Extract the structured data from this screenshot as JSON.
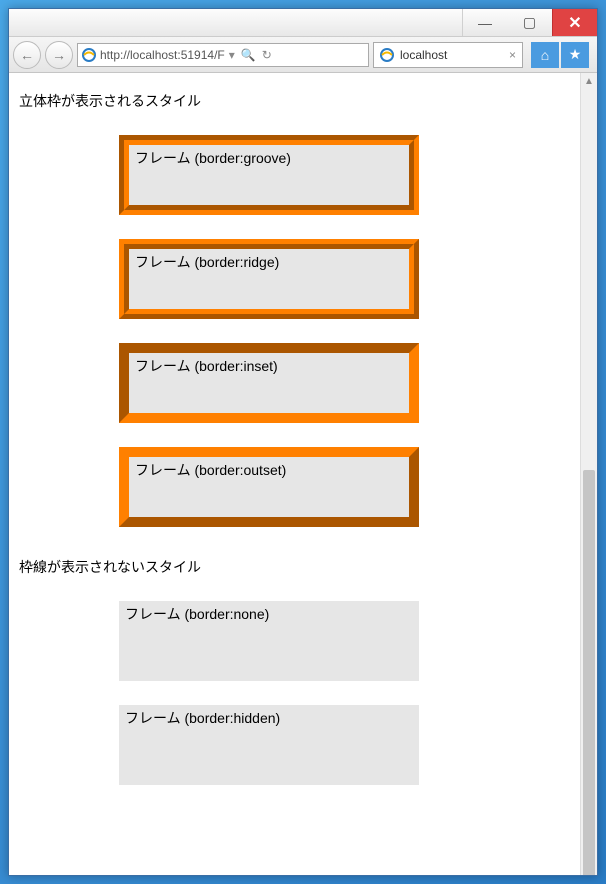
{
  "window": {
    "minimize_glyph": "—",
    "maximize_glyph": "▢",
    "close_glyph": "✕"
  },
  "nav": {
    "back_glyph": "←",
    "forward_glyph": "→",
    "url_display": "http://localhost:51914/F",
    "search_glyph": "🔍",
    "refresh_glyph": "↻",
    "dropdown_glyph": "▾",
    "tab_title": "localhost",
    "tab_close_glyph": "×",
    "home_glyph": "⌂",
    "star_glyph": "★"
  },
  "page": {
    "section1_title": "立体枠が表示されるスタイル",
    "section2_title": "枠線が表示されないスタイル",
    "frames": {
      "groove": "フレーム (border:groove)",
      "ridge": "フレーム (border:ridge)",
      "inset": "フレーム (border:inset)",
      "outset": "フレーム (border:outset)",
      "none": "フレーム (border:none)",
      "hidden": "フレーム (border:hidden)"
    },
    "border_color": "#ff8000",
    "frame_bg": "#e6e6e6"
  }
}
